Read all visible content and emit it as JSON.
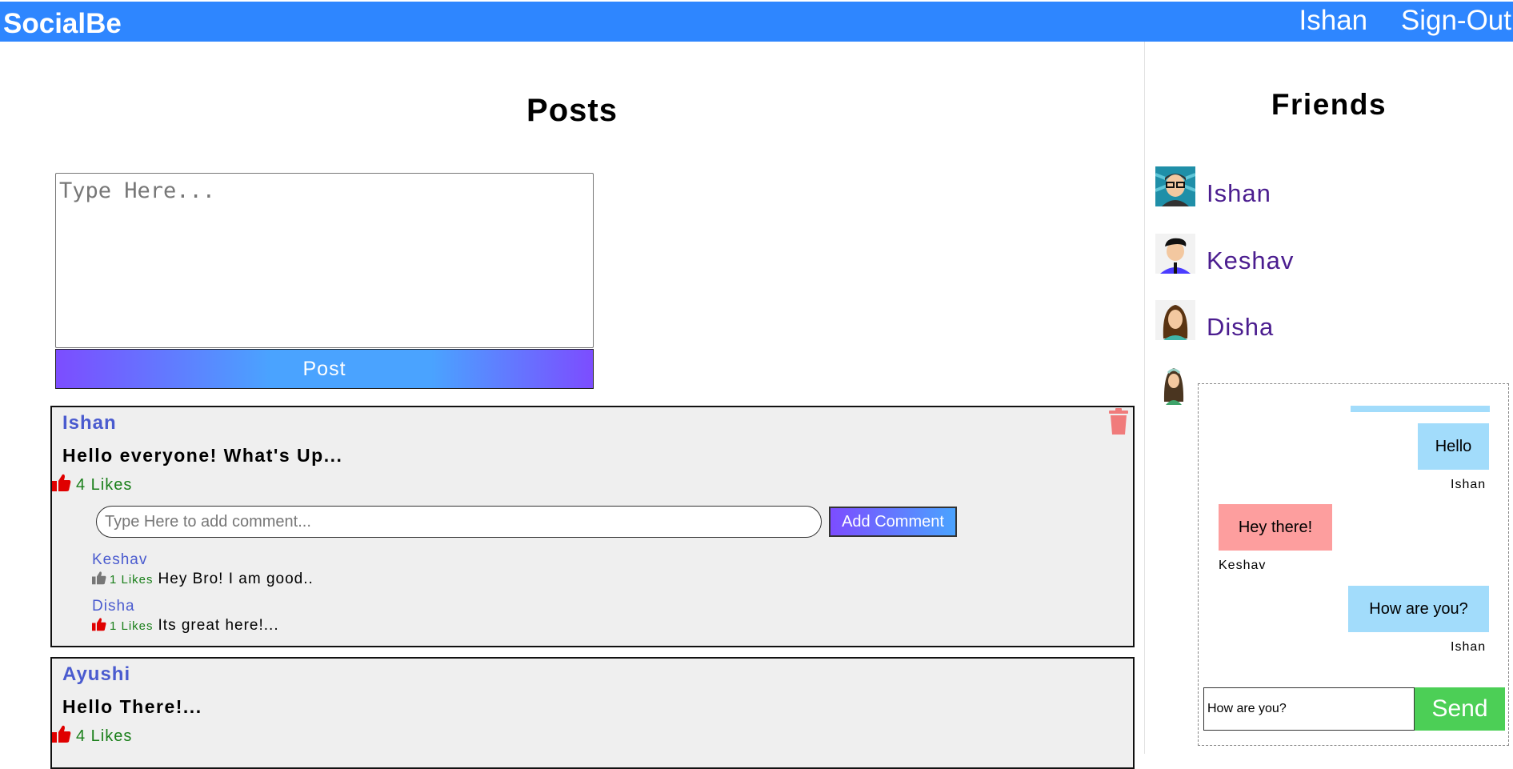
{
  "navbar": {
    "brand": "SocialBe",
    "user": "Ishan",
    "signout": "Sign-Out"
  },
  "posts": {
    "title": "Posts",
    "textarea_placeholder": "Type Here...",
    "post_button": "Post",
    "comment_placeholder": "Type Here to add comment...",
    "add_comment_label": "Add Comment",
    "items": [
      {
        "author": "Ishan",
        "content": "Hello everyone! What's Up...",
        "likes": "4 Likes",
        "comments": [
          {
            "author": "Keshav",
            "likes": "1 Likes",
            "text": "Hey Bro! I am good..",
            "liked": false
          },
          {
            "author": "Disha",
            "likes": "1 Likes",
            "text": "Its great here!...",
            "liked": true
          }
        ]
      },
      {
        "author": "Ayushi",
        "content": "Hello There!...",
        "likes": "4 Likes"
      }
    ]
  },
  "friends": {
    "title": "Friends",
    "list": [
      {
        "name": "Ishan"
      },
      {
        "name": "Keshav"
      },
      {
        "name": "Disha"
      }
    ]
  },
  "chat": {
    "messages": [
      {
        "text": "Hello",
        "sender": "Ishan",
        "side": "right"
      },
      {
        "text": "Hey there!",
        "sender": "Keshav",
        "side": "left"
      },
      {
        "text": "How are you?",
        "sender": "Ishan",
        "side": "right"
      }
    ],
    "input_value": "How are you?",
    "send_label": "Send"
  },
  "colors": {
    "navbar": "#2e86ff",
    "author": "#4a5bcf",
    "likes": "#1a7f1a",
    "like_icon": "#e00000",
    "friend_name": "#4b1d8f",
    "bubble_me": "#a2dcfb",
    "bubble_them": "#fd9e9e",
    "send": "#4ccf56"
  },
  "icons": [
    "thumbs-up-icon",
    "trash-icon",
    "avatar-icon"
  ]
}
